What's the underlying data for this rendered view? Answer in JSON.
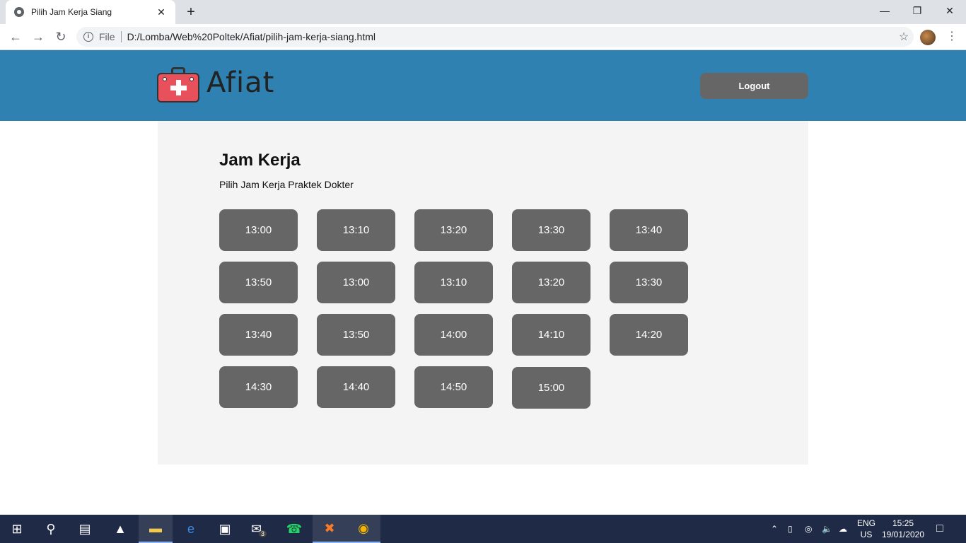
{
  "browser": {
    "tab_title": "Pilih Jam Kerja Siang",
    "close_glyph": "✕",
    "newtab_glyph": "+",
    "scheme": "File",
    "url": "D:/Lomba/Web%20Poltek/Afiat/pilih-jam-kerja-siang.html"
  },
  "header": {
    "logo_text": "Afiat",
    "logout_label": "Logout",
    "background": "#2e81b1"
  },
  "main": {
    "title": "Jam Kerja",
    "subtitle": "Pilih Jam Kerja Praktek Dokter",
    "slots": [
      "13:00",
      "13:10",
      "13:20",
      "13:30",
      "13:40",
      "13:50",
      "13:00",
      "13:10",
      "13:20",
      "13:30",
      "13:40",
      "13:50",
      "14:00",
      "14:10",
      "14:20",
      "14:30",
      "14:40",
      "14:50",
      "15:00"
    ]
  },
  "taskbar": {
    "lang_line1": "ENG",
    "lang_line2": "US",
    "time": "15:25",
    "date": "19/01/2020",
    "mail_badge": "3"
  }
}
